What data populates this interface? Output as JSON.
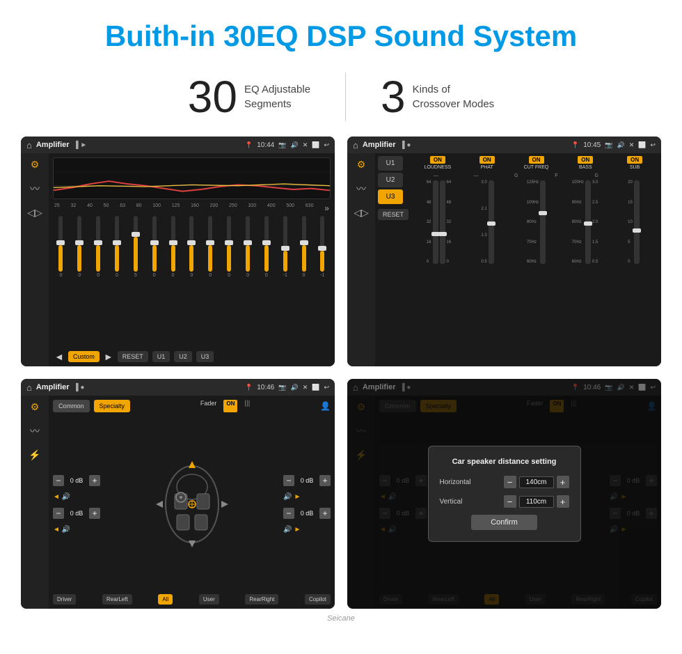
{
  "page": {
    "title": "Buith-in 30EQ DSP Sound System",
    "stat1_number": "30",
    "stat1_label_line1": "EQ Adjustable",
    "stat1_label_line2": "Segments",
    "stat2_number": "3",
    "stat2_label_line1": "Kinds of",
    "stat2_label_line2": "Crossover Modes",
    "watermark": "Seicane"
  },
  "screen1": {
    "app_title": "Amplifier",
    "time": "10:44",
    "freq_labels": [
      "25",
      "32",
      "40",
      "50",
      "63",
      "80",
      "100",
      "125",
      "160",
      "200",
      "250",
      "320",
      "400",
      "500",
      "630"
    ],
    "slider_values": [
      "0",
      "0",
      "0",
      "0",
      "5",
      "0",
      "0",
      "0",
      "0",
      "0",
      "0",
      "0",
      "-1",
      "0",
      "-1"
    ],
    "bottom_btns": [
      "Custom",
      "RESET",
      "U1",
      "U2",
      "U3"
    ]
  },
  "screen2": {
    "app_title": "Amplifier",
    "time": "10:45",
    "channels": [
      "LOUDNESS",
      "PHAT",
      "CUT FREQ",
      "BASS",
      "SUB"
    ],
    "presets": [
      "U1",
      "U2",
      "U3"
    ],
    "active_preset": "U3"
  },
  "screen3": {
    "app_title": "Amplifier",
    "time": "10:46",
    "tabs": [
      "Common",
      "Specialty"
    ],
    "active_tab": "Specialty",
    "fader_label": "Fader",
    "fader_on": "ON",
    "db_values": [
      "0 dB",
      "0 dB",
      "0 dB",
      "0 dB"
    ],
    "zone_btns": [
      "Driver",
      "RearLeft",
      "All",
      "User",
      "RearRight",
      "Copilot"
    ]
  },
  "screen4": {
    "app_title": "Amplifier",
    "time": "10:46",
    "tabs": [
      "Common",
      "Specialty"
    ],
    "dialog": {
      "title": "Car speaker distance setting",
      "horiz_label": "Horizontal",
      "horiz_value": "140cm",
      "vert_label": "Vertical",
      "vert_value": "110cm",
      "confirm_label": "Confirm"
    }
  }
}
